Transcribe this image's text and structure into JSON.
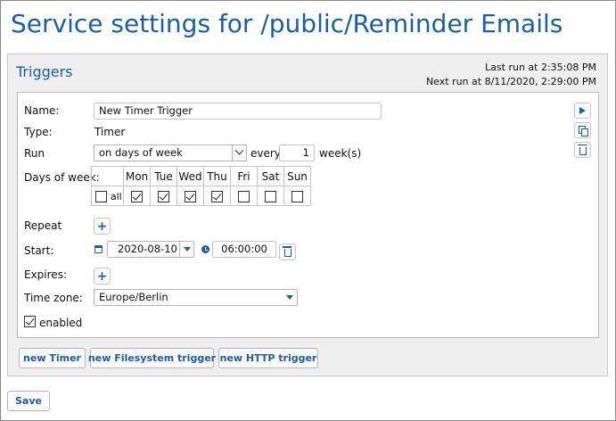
{
  "page": {
    "title": "Service settings for /public/Reminder Emails"
  },
  "triggers": {
    "title": "Triggers",
    "last_run": "Last run at 2:35:08 PM",
    "next_run": "Next run at 8/11/2020, 2:29:00 PM"
  },
  "trigger": {
    "name_label": "Name:",
    "name_value": "New Timer Trigger",
    "type_label": "Type:",
    "type_value": "Timer",
    "run_label": "Run",
    "run_value": "on days of week",
    "every_label": "every",
    "every_value": "1",
    "every_unit": "week(s)",
    "days_label": "Days of week:",
    "days": [
      {
        "label": "Mon",
        "checked": true
      },
      {
        "label": "Tue",
        "checked": true
      },
      {
        "label": "Wed",
        "checked": true
      },
      {
        "label": "Thu",
        "checked": true
      },
      {
        "label": "Fri",
        "checked": false
      },
      {
        "label": "Sat",
        "checked": false
      },
      {
        "label": "Sun",
        "checked": false
      }
    ],
    "all_label": "all",
    "repeat_label": "Repeat",
    "start_label": "Start:",
    "start_date": "2020-08-10",
    "start_time": "06:00:00",
    "expires_label": "Expires:",
    "timezone_label": "Time zone:",
    "timezone_value": "Europe/Berlin",
    "enabled_label": "enabled"
  },
  "buttons": {
    "new_timer": "new Timer",
    "new_filesystem": "new Filesystem trigger",
    "new_http": "new HTTP trigger",
    "save": "Save"
  },
  "colors": {
    "accent": "#1a5fa8",
    "panel": "#efefef"
  }
}
